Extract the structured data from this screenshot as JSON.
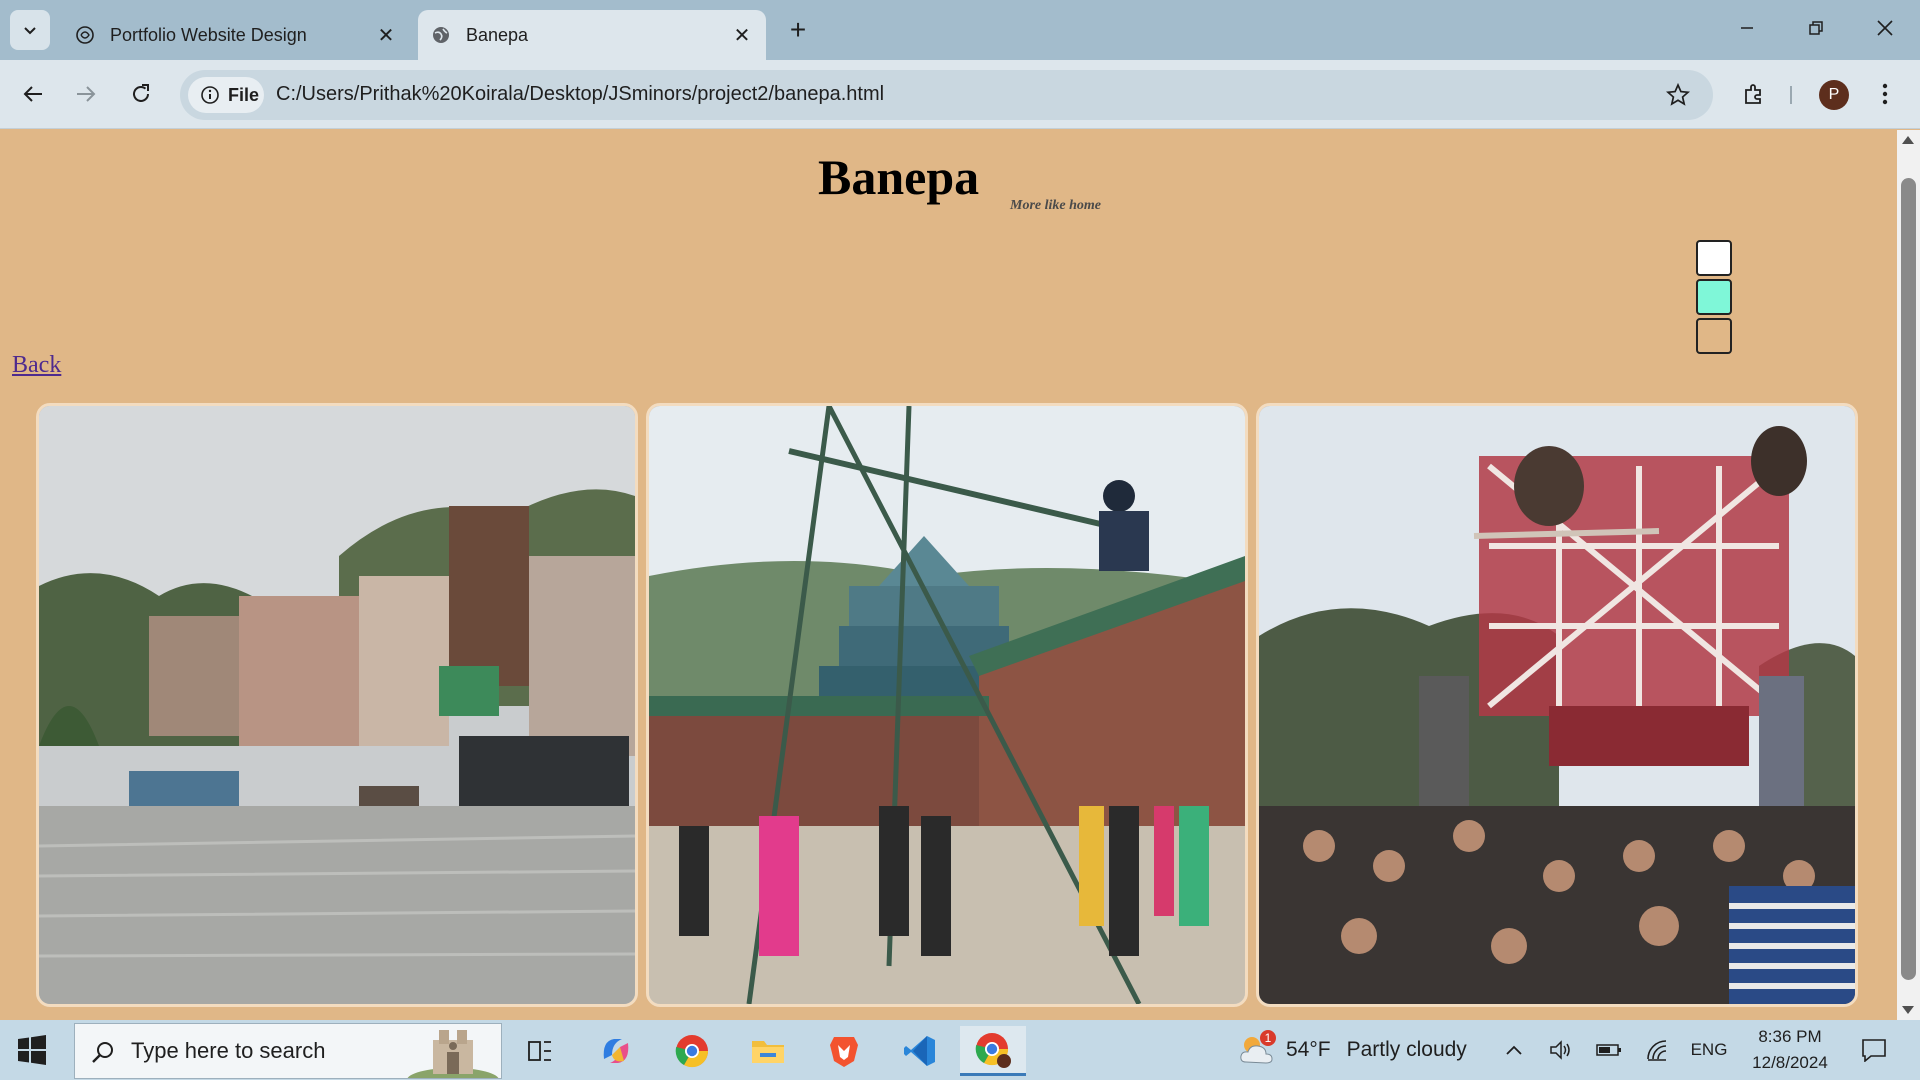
{
  "browser": {
    "tabs": [
      {
        "title": "Portfolio Website Design",
        "active": false,
        "favicon": "chatgpt-icon"
      },
      {
        "title": "Banepa",
        "active": true,
        "favicon": "globe-icon"
      }
    ],
    "omnibox": {
      "chip_label": "File",
      "url": "C:/Users/Prithak%20Koirala/Desktop/JSminors/project2/banepa.html"
    },
    "profile_initial": "P"
  },
  "page": {
    "title": "Banepa",
    "tagline": "More like home",
    "back_link": "Back",
    "theme_options": [
      {
        "color": "#ffffff"
      },
      {
        "color": "#7ff7d8"
      },
      {
        "color": "#e0b787"
      }
    ],
    "gallery": [
      {
        "subject": "flooded-street-photo"
      },
      {
        "subject": "bamboo-swing-temple-photo"
      },
      {
        "subject": "chariot-festival-crowd-photo"
      }
    ]
  },
  "taskbar": {
    "search_placeholder": "Type here to search",
    "pinned": [
      "task-view-icon",
      "copilot-icon",
      "chrome-icon",
      "file-explorer-icon",
      "brave-icon",
      "vscode-icon",
      "chrome-profile-icon"
    ],
    "weather": {
      "temp": "54°F",
      "condition": "Partly cloudy",
      "badge": "1"
    },
    "language": "ENG",
    "time": "8:36 PM",
    "date": "12/8/2024"
  }
}
